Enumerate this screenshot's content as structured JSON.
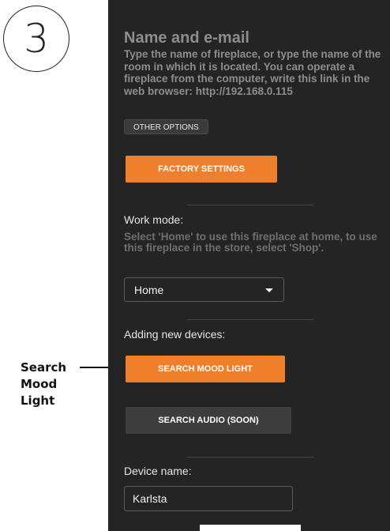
{
  "annotation": {
    "step_number": "3",
    "callout": [
      "Search",
      "Mood",
      "Light"
    ]
  },
  "screen": {
    "title": "Name and e-mail",
    "description": "Type the name of fireplace, or type the name of the room in which it is located. You can operate a fireplace from the computer, write this link in the web browser: http://192.168.0.115",
    "other_options_label": "OTHER OPTIONS",
    "factory_settings_label": "FACTORY SETTINGS",
    "work_mode": {
      "label": "Work mode:",
      "hint": "Select 'Home' to use this fireplace at home, to use this fireplace in the store, select 'Shop'.",
      "selected": "Home"
    },
    "adding_devices": {
      "label": "Adding new devices:",
      "search_mood_light_label": "SEARCH MOOD LIGHT",
      "search_audio_label": "SEARCH AUDIO (SOON)"
    },
    "device_name": {
      "label": "Device name:",
      "value": "Karlsta"
    }
  },
  "colors": {
    "screen_bg": "#242424",
    "accent_orange": "#f07f2c",
    "button_gray": "#3d3d3d"
  }
}
